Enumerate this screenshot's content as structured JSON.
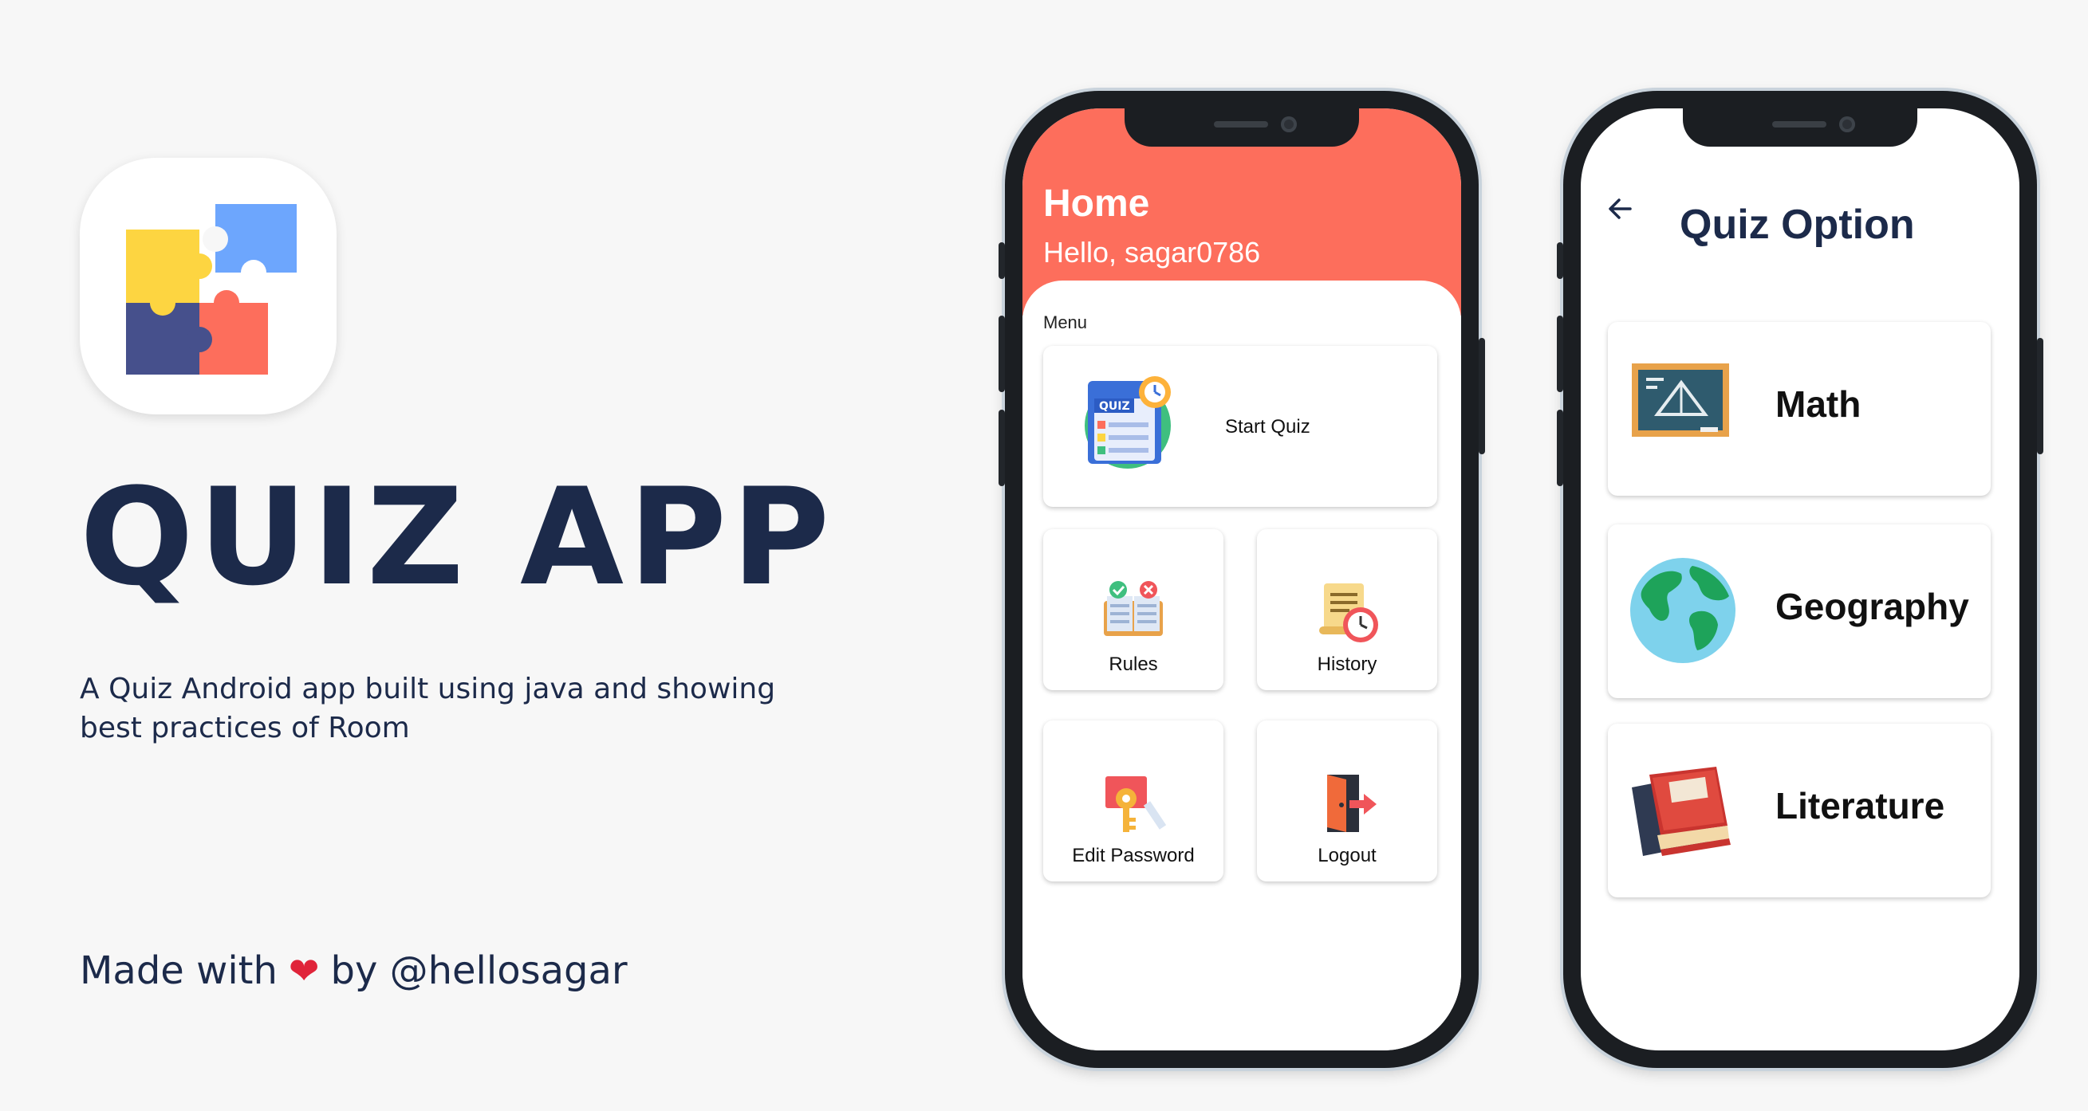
{
  "promo": {
    "title": "QUIZ APP",
    "description": "A Quiz Android app built using java and showing best practices of Room",
    "credit_prefix": "Made with",
    "credit_icon": "heart-icon",
    "credit_suffix": "by @hellosagar"
  },
  "colors": {
    "accent": "#fd6e5c",
    "navy": "#1c2a4a",
    "puzzle_yellow": "#fdd541",
    "puzzle_blue": "#6da6fd",
    "puzzle_indigo": "#46508c",
    "puzzle_coral": "#fd6e5c"
  },
  "home_screen": {
    "title": "Home",
    "greeting": "Hello, sagar0786",
    "menu_label": "Menu",
    "items": [
      {
        "label": "Start Quiz",
        "icon": "quiz-icon"
      },
      {
        "label": "Rules",
        "icon": "rules-book-icon"
      },
      {
        "label": "History",
        "icon": "history-clock-icon"
      },
      {
        "label": "Edit Password",
        "icon": "key-icon"
      },
      {
        "label": "Logout",
        "icon": "logout-door-icon"
      }
    ]
  },
  "quiz_option_screen": {
    "title": "Quiz Option",
    "back_icon": "back-arrow-icon",
    "options": [
      {
        "label": "Math",
        "icon": "blackboard-icon"
      },
      {
        "label": "Geography",
        "icon": "globe-icon"
      },
      {
        "label": "Literature",
        "icon": "books-icon"
      }
    ]
  }
}
